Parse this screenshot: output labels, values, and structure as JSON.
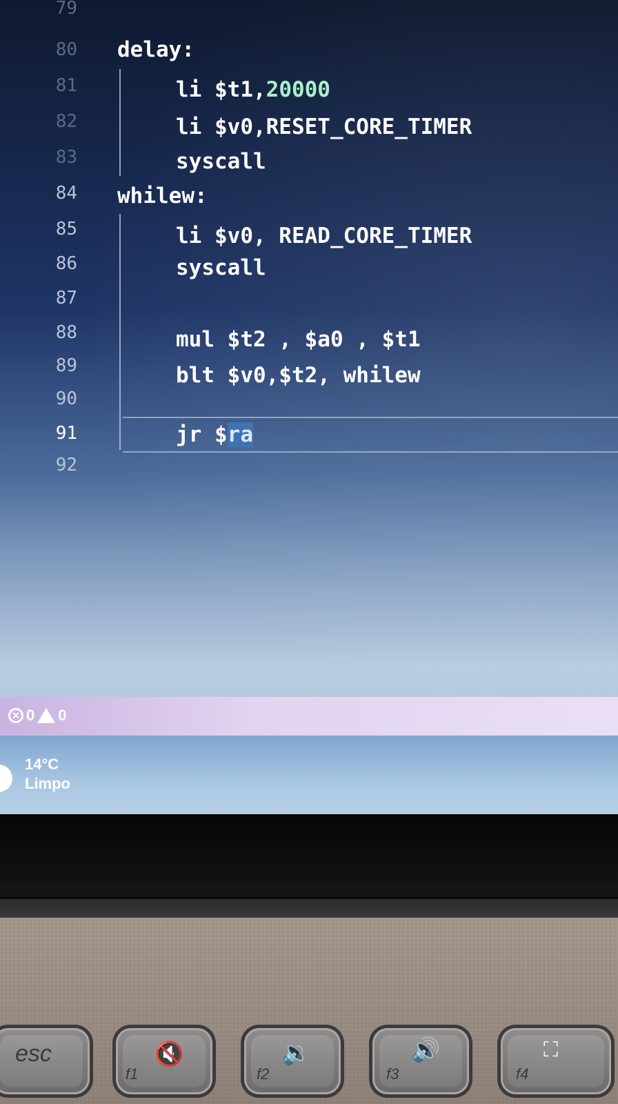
{
  "editor": {
    "lines": [
      {
        "num": "79",
        "text": ""
      },
      {
        "num": "80",
        "text": "delay:"
      },
      {
        "num": "81",
        "text_prefix": "li $t1,",
        "text_number": "20000"
      },
      {
        "num": "82",
        "text": "li $v0,RESET_CORE_TIMER"
      },
      {
        "num": "83",
        "text": "syscall"
      },
      {
        "num": "84",
        "text": "whilew:"
      },
      {
        "num": "85",
        "text": "li $v0, READ_CORE_TIMER"
      },
      {
        "num": "86",
        "text": "syscall"
      },
      {
        "num": "87",
        "text": ""
      },
      {
        "num": "88",
        "text": "mul $t2 , $a0 , $t1"
      },
      {
        "num": "89",
        "text": "blt $v0,$t2, whilew"
      },
      {
        "num": "90",
        "text": ""
      },
      {
        "num": "91",
        "text_prefix": "jr $",
        "text_selected": "ra"
      },
      {
        "num": "92",
        "text": ""
      }
    ],
    "active_line": "91"
  },
  "statusbar": {
    "errors": "0",
    "warnings": "0"
  },
  "taskbar": {
    "weather_temp": "14°C",
    "weather_desc": "Limpo"
  },
  "keyboard": {
    "keys": [
      {
        "label": "esc",
        "icon": ""
      },
      {
        "label": "f1",
        "icon": "mute-icon"
      },
      {
        "label": "f2",
        "icon": "volume-down-icon"
      },
      {
        "label": "f3",
        "icon": "volume-up-icon"
      },
      {
        "label": "f4",
        "icon": "display-icon"
      }
    ]
  },
  "colors": {
    "code_text": "#ffffff",
    "number_literal": "#a9f0c8",
    "selection": "#3a6fb0",
    "statusbar": "#d9c6ea"
  }
}
